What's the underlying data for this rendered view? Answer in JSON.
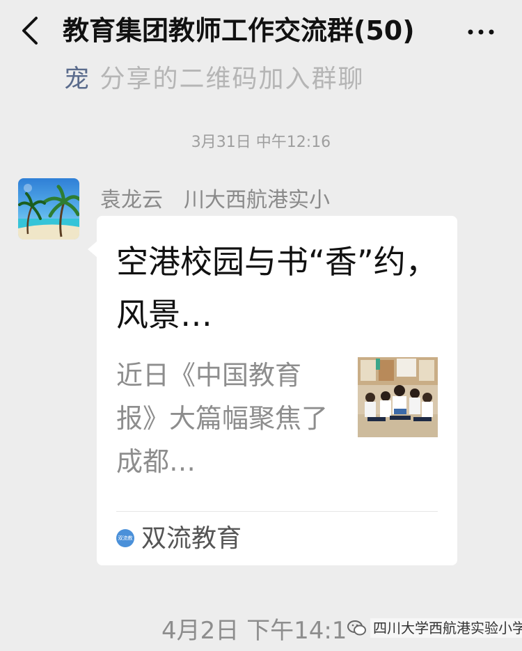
{
  "header": {
    "title": "教育集团教师工作交流群(50)",
    "back_icon": "chevron-left-icon",
    "more_icon": "ellipsis-icon"
  },
  "previous_message": {
    "first_char": "宠",
    "rest": "分享的二维码加入群聊"
  },
  "timestamps": {
    "first": "3月31日 中午12:16",
    "second": "4月2日 下午14:1"
  },
  "message": {
    "sender_name": "袁龙云",
    "sender_org": "川大西航港实小",
    "card": {
      "title": "空港校园与书“香”约，风景…",
      "description": "近日《中国教育报》大篇幅聚焦了成都…",
      "source_icon_text": "双流教育",
      "source_name": "双流教育"
    }
  },
  "watermark": {
    "text": "四川大学西航港实验小学",
    "icon": "wechat-official-account-icon"
  },
  "colors": {
    "background": "#ededed",
    "card": "#ffffff",
    "muted_text": "#8d8d8d",
    "source_icon": "#4a90d9"
  }
}
